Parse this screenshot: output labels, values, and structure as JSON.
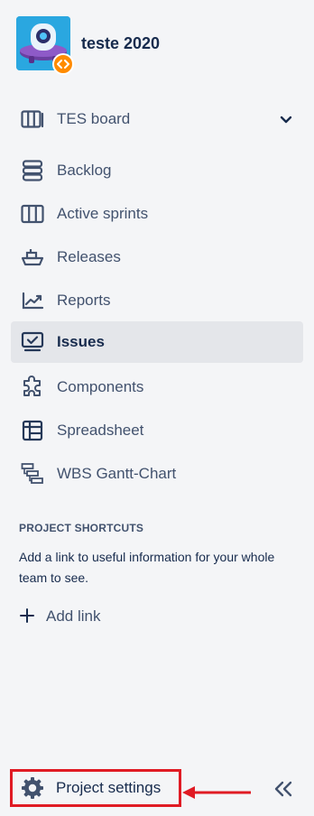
{
  "project": {
    "name": "teste 2020",
    "avatar_icon": "robot-avatar-icon",
    "badge_icon": "code-badge-icon"
  },
  "board_selector": {
    "label": "TES board",
    "icon": "board-icon"
  },
  "nav": [
    {
      "label": "Backlog",
      "icon": "backlog-icon"
    },
    {
      "label": "Active sprints",
      "icon": "columns-icon"
    },
    {
      "label": "Releases",
      "icon": "ship-icon"
    },
    {
      "label": "Reports",
      "icon": "chart-icon"
    },
    {
      "label": "Issues",
      "icon": "issues-icon",
      "active": true
    },
    {
      "label": "Components",
      "icon": "puzzle-icon"
    },
    {
      "label": "Spreadsheet",
      "icon": "spreadsheet-icon"
    },
    {
      "label": "WBS Gantt-Chart",
      "icon": "gantt-icon"
    }
  ],
  "shortcuts": {
    "title": "PROJECT SHORTCUTS",
    "description": "Add a link to useful information for your whole team to see.",
    "add_label": "Add link"
  },
  "footer": {
    "settings_label": "Project settings"
  },
  "colors": {
    "sidebar_bg": "#f4f5f7",
    "active_bg": "#e4e6ea",
    "text": "#172b4d",
    "muted": "#42526e",
    "highlight_red": "#e01b24",
    "avatar_blue": "#2aa7e0",
    "badge_orange": "#ff8b00"
  }
}
